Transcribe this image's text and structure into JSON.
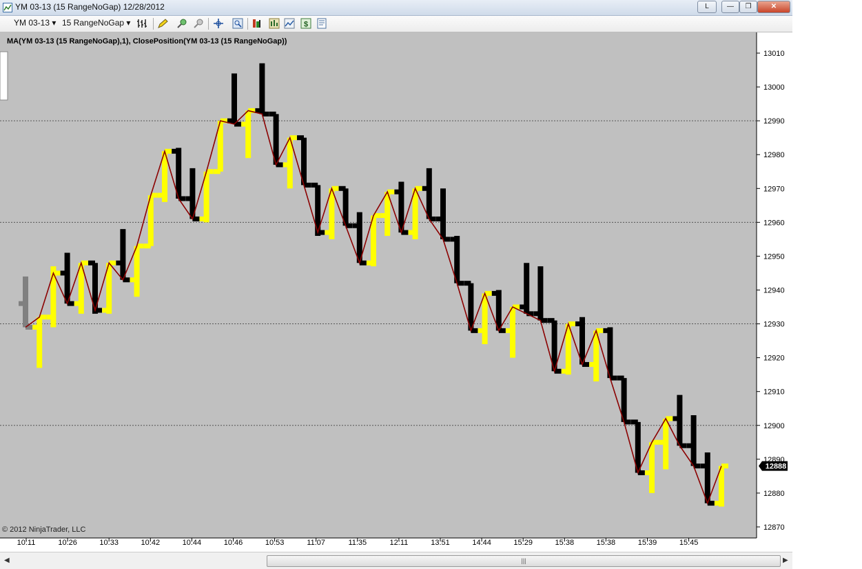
{
  "window": {
    "title": "YM 03-13 (15 RangeNoGap)  12/28/2012",
    "right_label": "L",
    "minimize_glyph": "—",
    "restore_glyph": "❐",
    "close_glyph": "✕"
  },
  "toolbar": {
    "instrument": "YM 03-13",
    "period": "15 RangeNoGap",
    "dropdown_glyph": "▾",
    "icons": [
      "bar-type-icon",
      "draw-pencil-icon",
      "zoom-in-icon",
      "zoom-out-icon",
      "crosshair-icon",
      "magnify-icon",
      "indicators-icon",
      "strategies-icon",
      "chart-trader-icon",
      "dollar-icon",
      "properties-icon"
    ]
  },
  "colors": {
    "chart_bg": "#c0c0c0",
    "up_bar": "#ffff00",
    "down_bar": "#000000",
    "ghost_bar": "#808080",
    "indicator_line": "#8b0000"
  },
  "chart_data": {
    "type": "bar",
    "indicator_label": "MA(YM 03-13 (15 RangeNoGap),1), ClosePosition(YM 03-13 (15 RangeNoGap))",
    "copyright": "© 2012 NinjaTrader, LLC",
    "last_price": "12888",
    "ylim": [
      12868,
      13015
    ],
    "y_ticks": [
      13010,
      13000,
      12990,
      12980,
      12970,
      12960,
      12950,
      12940,
      12930,
      12920,
      12910,
      12900,
      12890,
      12880,
      12870
    ],
    "dotted_lines": [
      12990,
      12960,
      12930,
      12900
    ],
    "x_ticks": [
      "10:11",
      "10:26",
      "10:33",
      "10:42",
      "10:44",
      "10:46",
      "10:53",
      "11:07",
      "11:35",
      "12:11",
      "13:51",
      "14:44",
      "15:29",
      "15:38",
      "15:38",
      "15:39",
      "15:45"
    ],
    "bars": [
      {
        "dir": "ghost",
        "high": 12944,
        "low": 12929,
        "open": 12936,
        "close": 12929
      },
      {
        "dir": "up",
        "high": 12932,
        "low": 12917,
        "open": 12929,
        "close": 12932
      },
      {
        "dir": "up",
        "high": 12947,
        "low": 12929,
        "open": 12932,
        "close": 12945
      },
      {
        "dir": "down",
        "high": 12951,
        "low": 12936,
        "open": 12945,
        "close": 12936
      },
      {
        "dir": "up",
        "high": 12948,
        "low": 12933,
        "open": 12936,
        "close": 12948
      },
      {
        "dir": "down",
        "high": 12948,
        "low": 12933,
        "open": 12948,
        "close": 12934
      },
      {
        "dir": "up",
        "high": 12948,
        "low": 12933,
        "open": 12934,
        "close": 12948
      },
      {
        "dir": "down",
        "high": 12958,
        "low": 12943,
        "open": 12948,
        "close": 12943
      },
      {
        "dir": "up",
        "high": 12953,
        "low": 12938,
        "open": 12943,
        "close": 12953
      },
      {
        "dir": "up",
        "high": 12968,
        "low": 12953,
        "open": 12953,
        "close": 12968
      },
      {
        "dir": "up",
        "high": 12981,
        "low": 12966,
        "open": 12968,
        "close": 12981
      },
      {
        "dir": "down",
        "high": 12982,
        "low": 12967,
        "open": 12981,
        "close": 12967
      },
      {
        "dir": "down",
        "high": 12976,
        "low": 12961,
        "open": 12967,
        "close": 12961
      },
      {
        "dir": "up",
        "high": 12975,
        "low": 12960,
        "open": 12961,
        "close": 12975
      },
      {
        "dir": "up",
        "high": 12990,
        "low": 12975,
        "open": 12975,
        "close": 12990
      },
      {
        "dir": "down",
        "high": 13004,
        "low": 12989,
        "open": 12990,
        "close": 12989
      },
      {
        "dir": "up",
        "high": 12993,
        "low": 12979,
        "open": 12989,
        "close": 12993
      },
      {
        "dir": "down",
        "high": 13007,
        "low": 12992,
        "open": 12993,
        "close": 12992
      },
      {
        "dir": "down",
        "high": 12992,
        "low": 12977,
        "open": 12992,
        "close": 12977
      },
      {
        "dir": "up",
        "high": 12985,
        "low": 12970,
        "open": 12977,
        "close": 12985
      },
      {
        "dir": "down",
        "high": 12985,
        "low": 12971,
        "open": 12985,
        "close": 12971
      },
      {
        "dir": "down",
        "high": 12971,
        "low": 12956,
        "open": 12971,
        "close": 12957
      },
      {
        "dir": "up",
        "high": 12970,
        "low": 12955,
        "open": 12957,
        "close": 12970
      },
      {
        "dir": "down",
        "high": 12970,
        "low": 12959,
        "open": 12970,
        "close": 12959
      },
      {
        "dir": "down",
        "high": 12963,
        "low": 12948,
        "open": 12959,
        "close": 12948
      },
      {
        "dir": "up",
        "high": 12962,
        "low": 12947,
        "open": 12948,
        "close": 12962
      },
      {
        "dir": "up",
        "high": 12969,
        "low": 12956,
        "open": 12962,
        "close": 12969
      },
      {
        "dir": "down",
        "high": 12972,
        "low": 12957,
        "open": 12969,
        "close": 12957
      },
      {
        "dir": "up",
        "high": 12970,
        "low": 12955,
        "open": 12957,
        "close": 12970
      },
      {
        "dir": "down",
        "high": 12976,
        "low": 12961,
        "open": 12970,
        "close": 12961
      },
      {
        "dir": "down",
        "high": 12970,
        "low": 12955,
        "open": 12961,
        "close": 12955
      },
      {
        "dir": "down",
        "high": 12956,
        "low": 12942,
        "open": 12955,
        "close": 12942
      },
      {
        "dir": "down",
        "high": 12942,
        "low": 12928,
        "open": 12942,
        "close": 12928
      },
      {
        "dir": "up",
        "high": 12939,
        "low": 12924,
        "open": 12928,
        "close": 12939
      },
      {
        "dir": "down",
        "high": 12940,
        "low": 12928,
        "open": 12939,
        "close": 12928
      },
      {
        "dir": "up",
        "high": 12935,
        "low": 12920,
        "open": 12928,
        "close": 12935
      },
      {
        "dir": "down",
        "high": 12948,
        "low": 12933,
        "open": 12935,
        "close": 12933
      },
      {
        "dir": "down",
        "high": 12947,
        "low": 12931,
        "open": 12933,
        "close": 12931
      },
      {
        "dir": "down",
        "high": 12931,
        "low": 12916,
        "open": 12931,
        "close": 12916
      },
      {
        "dir": "up",
        "high": 12930,
        "low": 12915,
        "open": 12916,
        "close": 12930
      },
      {
        "dir": "down",
        "high": 12932,
        "low": 12918,
        "open": 12930,
        "close": 12918
      },
      {
        "dir": "up",
        "high": 12928,
        "low": 12913,
        "open": 12918,
        "close": 12928
      },
      {
        "dir": "down",
        "high": 12929,
        "low": 12914,
        "open": 12928,
        "close": 12914
      },
      {
        "dir": "down",
        "high": 12914,
        "low": 12901,
        "open": 12914,
        "close": 12901
      },
      {
        "dir": "down",
        "high": 12901,
        "low": 12886,
        "open": 12901,
        "close": 12886
      },
      {
        "dir": "up",
        "high": 12895,
        "low": 12880,
        "open": 12886,
        "close": 12895
      },
      {
        "dir": "up",
        "high": 12902,
        "low": 12887,
        "open": 12895,
        "close": 12902
      },
      {
        "dir": "down",
        "high": 12909,
        "low": 12894,
        "open": 12902,
        "close": 12894
      },
      {
        "dir": "down",
        "high": 12903,
        "low": 12888,
        "open": 12894,
        "close": 12888
      },
      {
        "dir": "down",
        "high": 12892,
        "low": 12877,
        "open": 12888,
        "close": 12877
      },
      {
        "dir": "up",
        "high": 12888,
        "low": 12876,
        "open": 12877,
        "close": 12888
      }
    ]
  }
}
